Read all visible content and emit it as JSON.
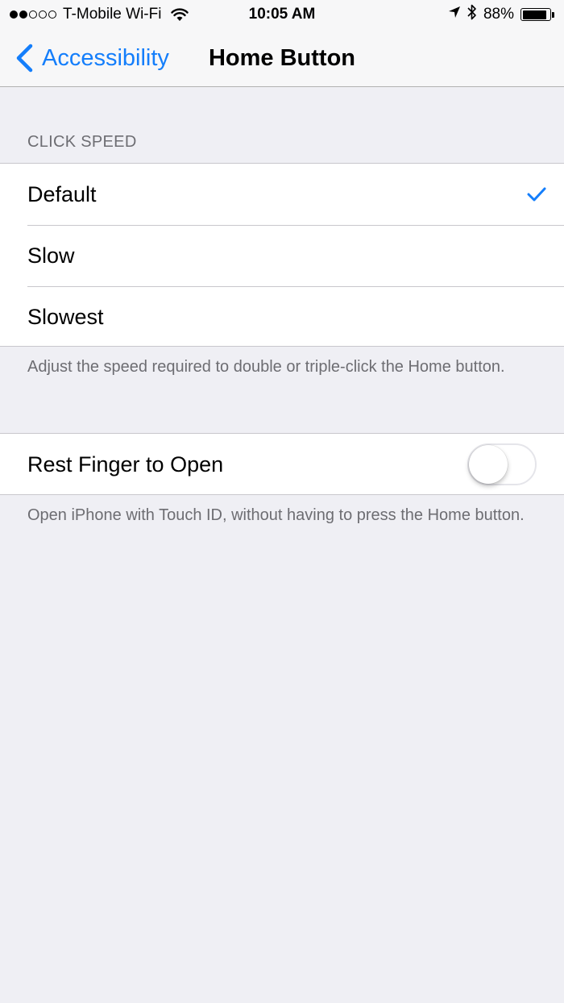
{
  "status_bar": {
    "signal_bars_filled": 2,
    "signal_bars_total": 5,
    "carrier": "T-Mobile Wi-Fi",
    "time": "10:05 AM",
    "battery_percent": "88%",
    "battery_level": 0.88,
    "icons": [
      "wifi-icon",
      "location-arrow-icon",
      "bluetooth-icon",
      "battery-icon"
    ]
  },
  "nav": {
    "back_label": "Accessibility",
    "title": "Home Button"
  },
  "click_speed": {
    "header": "CLICK SPEED",
    "options": [
      {
        "label": "Default",
        "selected": true
      },
      {
        "label": "Slow",
        "selected": false
      },
      {
        "label": "Slowest",
        "selected": false
      }
    ],
    "footer": "Adjust the speed required to double or triple-click the Home button."
  },
  "rest_finger": {
    "label": "Rest Finger to Open",
    "enabled": false,
    "footer": "Open iPhone with Touch ID, without having to press the Home button."
  },
  "colors": {
    "accent": "#147efb",
    "background": "#efeff4",
    "secondary_text": "#6d6d72",
    "separator": "#c8c7cc"
  }
}
